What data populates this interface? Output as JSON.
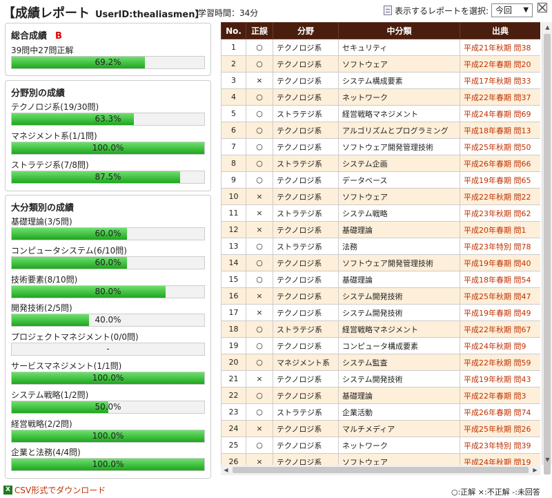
{
  "header": {
    "title": "【成績レポート",
    "userid": "UserID:thealiasmen】",
    "study_time": "学習時間：34分",
    "select_label": "表示するレポートを選択:",
    "select_value": "今回"
  },
  "overall": {
    "title": "総合成績",
    "grade": "B",
    "summary": "39問中27問正解",
    "pct": "69.2%",
    "ratio": 0.692
  },
  "field": {
    "title": "分野別の成績",
    "items": [
      {
        "label": "テクノロジ系(19/30問)",
        "pct": "63.3%",
        "ratio": 0.633
      },
      {
        "label": "マネジメント系(1/1問)",
        "pct": "100.0%",
        "ratio": 1.0
      },
      {
        "label": "ストラテジ系(7/8問)",
        "pct": "87.5%",
        "ratio": 0.875
      }
    ]
  },
  "major": {
    "title": "大分類別の成績",
    "items": [
      {
        "label": "基礎理論(3/5問)",
        "pct": "60.0%",
        "ratio": 0.6
      },
      {
        "label": "コンピュータシステム(6/10問)",
        "pct": "60.0%",
        "ratio": 0.6
      },
      {
        "label": "技術要素(8/10問)",
        "pct": "80.0%",
        "ratio": 0.8
      },
      {
        "label": "開発技術(2/5問)",
        "pct": "40.0%",
        "ratio": 0.4
      },
      {
        "label": "プロジェクトマネジメント(0/0問)",
        "pct": "-",
        "ratio": 0
      },
      {
        "label": "サービスマネジメント(1/1問)",
        "pct": "100.0%",
        "ratio": 1.0
      },
      {
        "label": "システム戦略(1/2問)",
        "pct": "50.0%",
        "ratio": 0.5
      },
      {
        "label": "経営戦略(2/2問)",
        "pct": "100.0%",
        "ratio": 1.0
      },
      {
        "label": "企業と法務(4/4問)",
        "pct": "100.0%",
        "ratio": 1.0
      }
    ]
  },
  "table": {
    "headers": [
      "No.",
      "正誤",
      "分野",
      "中分類",
      "出典"
    ],
    "rows": [
      [
        "1",
        "○",
        "テクノロジ系",
        "セキュリティ",
        "平成21年秋期 問38"
      ],
      [
        "2",
        "○",
        "テクノロジ系",
        "ソフトウェア",
        "平成22年春期 問20"
      ],
      [
        "3",
        "×",
        "テクノロジ系",
        "システム構成要素",
        "平成17年秋期 問33"
      ],
      [
        "4",
        "○",
        "テクノロジ系",
        "ネットワーク",
        "平成22年春期 問37"
      ],
      [
        "5",
        "○",
        "ストラテジ系",
        "経営戦略マネジメント",
        "平成24年春期 問69"
      ],
      [
        "6",
        "○",
        "テクノロジ系",
        "アルゴリズムとプログラミング",
        "平成18年春期 問13"
      ],
      [
        "7",
        "○",
        "テクノロジ系",
        "ソフトウェア開発管理技術",
        "平成25年秋期 問50"
      ],
      [
        "8",
        "○",
        "ストラテジ系",
        "システム企画",
        "平成26年春期 問66"
      ],
      [
        "9",
        "○",
        "テクノロジ系",
        "データベース",
        "平成19年春期 問65"
      ],
      [
        "10",
        "×",
        "テクノロジ系",
        "ソフトウェア",
        "平成22年秋期 問22"
      ],
      [
        "11",
        "×",
        "ストラテジ系",
        "システム戦略",
        "平成23年秋期 問62"
      ],
      [
        "12",
        "×",
        "テクノロジ系",
        "基礎理論",
        "平成20年春期 問1"
      ],
      [
        "13",
        "○",
        "ストラテジ系",
        "法務",
        "平成23年特別 問78"
      ],
      [
        "14",
        "○",
        "テクノロジ系",
        "ソフトウェア開発管理技術",
        "平成19年春期 問40"
      ],
      [
        "15",
        "○",
        "テクノロジ系",
        "基礎理論",
        "平成18年春期 問54"
      ],
      [
        "16",
        "×",
        "テクノロジ系",
        "システム開発技術",
        "平成25年秋期 問47"
      ],
      [
        "17",
        "×",
        "テクノロジ系",
        "システム開発技術",
        "平成19年春期 問49"
      ],
      [
        "18",
        "○",
        "ストラテジ系",
        "経営戦略マネジメント",
        "平成22年秋期 問67"
      ],
      [
        "19",
        "○",
        "テクノロジ系",
        "コンピュータ構成要素",
        "平成24年秋期 問9"
      ],
      [
        "20",
        "○",
        "マネジメント系",
        "システム監査",
        "平成22年秋期 問59"
      ],
      [
        "21",
        "×",
        "テクノロジ系",
        "システム開発技術",
        "平成19年秋期 問43"
      ],
      [
        "22",
        "○",
        "テクノロジ系",
        "基礎理論",
        "平成22年春期 問3"
      ],
      [
        "23",
        "○",
        "ストラテジ系",
        "企業活動",
        "平成26年春期 問74"
      ],
      [
        "24",
        "×",
        "テクノロジ系",
        "マルチメディア",
        "平成25年秋期 問26"
      ],
      [
        "25",
        "○",
        "テクノロジ系",
        "ネットワーク",
        "平成23年特別 問39"
      ],
      [
        "26",
        "×",
        "テクノロジ系",
        "ソフトウェア",
        "平成24年秋期 問19"
      ]
    ]
  },
  "footer": {
    "csv": "CSV形式でダウンロード",
    "legend": "○:正解 ×:不正解 -:未回答"
  }
}
